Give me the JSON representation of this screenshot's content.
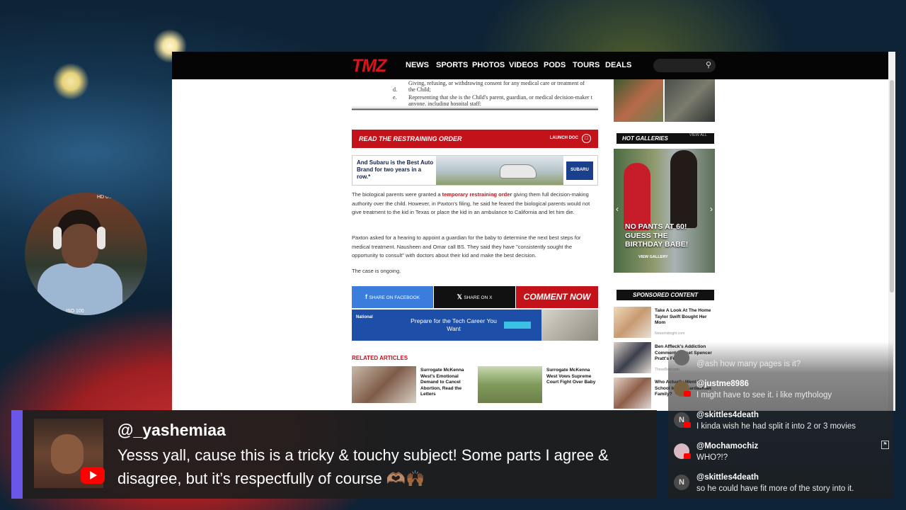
{
  "browser": {
    "logo": "TMZ",
    "nav": [
      "NEWS",
      "SPORTS",
      "PHOTOS",
      "VIDEOS",
      "PODS",
      "TOURS",
      "DEALS"
    ]
  },
  "document": {
    "lines": [
      {
        "mark": "",
        "text": "Giving, refusing, or withdrawing consent for any medical care or treatment of"
      },
      {
        "mark": "d.",
        "text": "the Child;"
      },
      {
        "mark": "e.",
        "text": "Representing that she is the Child's parent, guardian, or medical decision-maker to"
      },
      {
        "mark": "",
        "text": "anyone, including hospital staff;"
      }
    ]
  },
  "restraining": {
    "title": "READ THE RESTRAINING ORDER",
    "launch": "LAUNCH DOC"
  },
  "ad_subaru": {
    "text": "And Subaru is the Best Auto Brand for two years in a row.*",
    "logo": "SUBARU"
  },
  "article": {
    "p1_before": "The biological parents were granted a ",
    "p1_link": "temporary restraining order",
    "p1_after": " giving them full decision-making authority over the child. However, in Paxton's filing, he said he feared the biological parents would not give treatment to the kid in Texas or place the kid in an ambulance to California and let him die.",
    "p2": "Paxton asked for a hearing to appoint a guardian for the baby to determine the next best steps for medical treatment. Nausheen and Omar call BS. They said they have \"consistently sought the opportunity to consult\" with doctors about their kid and make the best decision.",
    "p3": "The case is ongoing."
  },
  "share": {
    "facebook": "SHARE ON FACEBOOK",
    "x": "SHARE ON X",
    "comment": "COMMENT NOW"
  },
  "ad_national": {
    "logo": "National",
    "text": "Prepare for the Tech Career You Want"
  },
  "related": {
    "title": "RELATED ARTICLES",
    "items": [
      "Surrogate McKenna West's Emotional Demand to Cancel Abortion, Read the Letters",
      "Surrogate McKenna West Vows Supreme Court Fight Over Baby"
    ]
  },
  "rail": {
    "hot_galleries": "HOT GALLERIES",
    "view_all": "VIEW ALL",
    "gallery_caption_1": "NO PANTS AT 60!",
    "gallery_caption_2": "GUESS THE",
    "gallery_caption_3": "BIRTHDAY BABE!",
    "view_gallery": "VIEW GALLERY",
    "sponsored": "SPONSORED CONTENT",
    "sponsored_items": [
      {
        "title": "Take A Look At The Home Taylor Swift Bought Her Mom",
        "src": "Newsmidnight.com"
      },
      {
        "title": "Ben Affleck's Addiction Comments Upset Spencer Pratt's Fury",
        "src": "TheseBest.com"
      },
      {
        "title": "Who Actually Went To School In The Kardashian Family?",
        "src": ""
      }
    ]
  },
  "webcam": {
    "hd": "HD 0.0",
    "iso": "ISO 100"
  },
  "highlight": {
    "user": "@_yashemiaa",
    "message": "Yesss yall, cause this is a tricky & touchy subject! Some parts I agree & disagree, but it’s respectfully of course 🫶🏽🙌🏾"
  },
  "chat": [
    {
      "user": "",
      "initial": "",
      "message": "@ash how many pages is it?"
    },
    {
      "user": "@justme8986",
      "initial": "",
      "message": "I might have to see it. i like mythology"
    },
    {
      "user": "@skittles4death",
      "initial": "N",
      "message": "I kinda wish he had split it into 2 or 3 movies"
    },
    {
      "user": "@Mochamochiz",
      "initial": "",
      "message": "WHO?!?"
    },
    {
      "user": "@skittles4death",
      "initial": "N",
      "message": "so he could have fit more of the story into it."
    }
  ]
}
